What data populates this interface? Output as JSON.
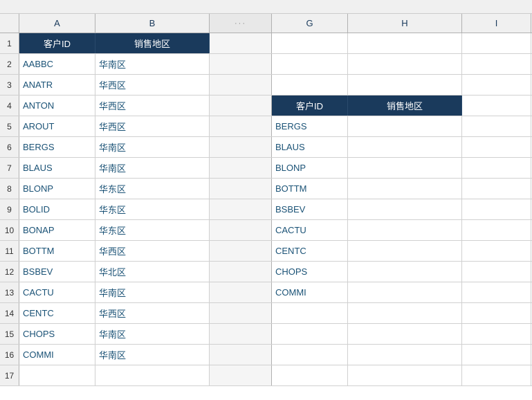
{
  "spreadsheet": {
    "topBar": "",
    "columns": {
      "A": "A",
      "B": "B",
      "G": "G",
      "H": "H",
      "I": "I"
    },
    "headers": {
      "row1_A": "客户ID",
      "row1_B": "销售地区",
      "row4_G": "客户ID",
      "row4_H": "销售地区"
    },
    "rows": [
      {
        "num": "1",
        "a": "客户ID",
        "b": "销售地区",
        "g": "",
        "h": "",
        "isHeader": true
      },
      {
        "num": "2",
        "a": "AABBC",
        "b": "华南区",
        "g": "",
        "h": ""
      },
      {
        "num": "3",
        "a": "ANATR",
        "b": "华西区",
        "g": "",
        "h": ""
      },
      {
        "num": "4",
        "a": "ANTON",
        "b": "华西区",
        "g": "客户ID",
        "h": "销售地区",
        "isHeader2": true
      },
      {
        "num": "5",
        "a": "AROUT",
        "b": "华西区",
        "g": "BERGS",
        "h": ""
      },
      {
        "num": "6",
        "a": "BERGS",
        "b": "华南区",
        "g": "BLAUS",
        "h": ""
      },
      {
        "num": "7",
        "a": "BLAUS",
        "b": "华南区",
        "g": "BLONP",
        "h": ""
      },
      {
        "num": "8",
        "a": "BLONP",
        "b": "华东区",
        "g": "BOTTM",
        "h": ""
      },
      {
        "num": "9",
        "a": "BOLID",
        "b": "华东区",
        "g": "BSBEV",
        "h": ""
      },
      {
        "num": "10",
        "a": "BONAP",
        "b": "华东区",
        "g": "CACTU",
        "h": ""
      },
      {
        "num": "11",
        "a": "BOTTM",
        "b": "华西区",
        "g": "CENTC",
        "h": ""
      },
      {
        "num": "12",
        "a": "BSBEV",
        "b": "华北区",
        "g": "CHOPS",
        "h": ""
      },
      {
        "num": "13",
        "a": "CACTU",
        "b": "华南区",
        "g": "COMMI",
        "h": ""
      },
      {
        "num": "14",
        "a": "CENTC",
        "b": "华西区",
        "g": "",
        "h": ""
      },
      {
        "num": "15",
        "a": "CHOPS",
        "b": "华南区",
        "g": "",
        "h": ""
      },
      {
        "num": "16",
        "a": "COMMI",
        "b": "华南区",
        "g": "",
        "h": ""
      },
      {
        "num": "17",
        "a": "",
        "b": "",
        "g": "",
        "h": ""
      }
    ]
  }
}
